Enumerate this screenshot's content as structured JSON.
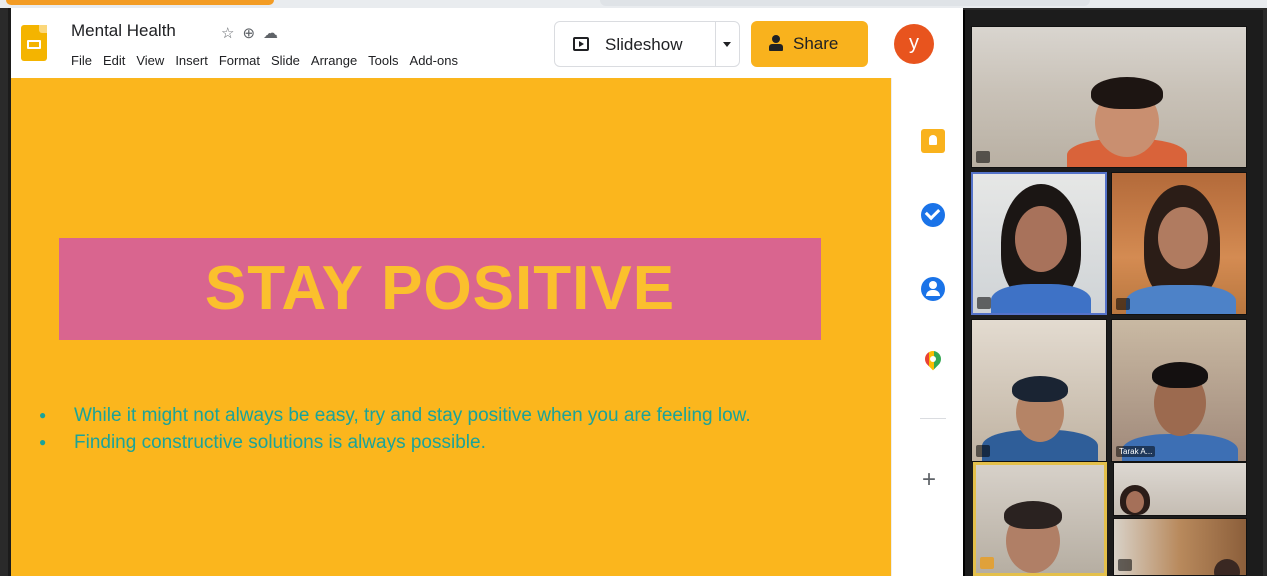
{
  "app": {
    "doc_title": "Mental Health",
    "menu": [
      "File",
      "Edit",
      "View",
      "Insert",
      "Format",
      "Slide",
      "Arrange",
      "Tools",
      "Add-ons"
    ],
    "slideshow_label": "Slideshow",
    "share_label": "Share",
    "avatar_initial": "y",
    "accent_color": "#f9b21d"
  },
  "slide": {
    "title": "STAY POSITIVE",
    "bullets": [
      "While it might not always be easy, try and stay positive when you are feeling low.",
      "Finding constructive solutions is always possible."
    ],
    "background_color": "#fbb61d",
    "title_box_color": "#d9658f",
    "title_text_color": "#fbc02d",
    "bullet_text_color": "#1aa39a"
  },
  "side_panel": {
    "icons": [
      "keep-icon",
      "tasks-icon",
      "contacts-icon",
      "maps-icon",
      "add-icon"
    ]
  },
  "video_call": {
    "participant_tiles": 8,
    "name_tags": [
      "Tarak A..."
    ]
  }
}
